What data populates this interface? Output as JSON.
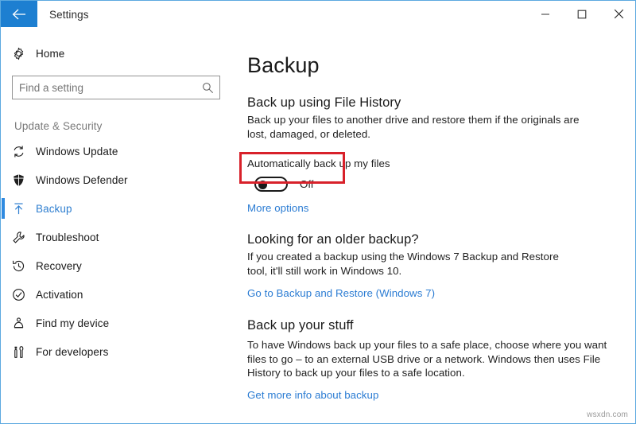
{
  "titlebar": {
    "back_icon": "arrow-left-icon",
    "app_title": "Settings",
    "minimize_label": "minimize-icon",
    "maximize_label": "maximize-icon",
    "close_label": "close-icon"
  },
  "sidebar": {
    "home": {
      "label": "Home",
      "icon": "gear-icon"
    },
    "search": {
      "value": "",
      "placeholder": "Find a setting",
      "icon": "search-icon"
    },
    "group_heading": "Update & Security",
    "items": [
      {
        "label": "Windows Update",
        "icon": "refresh-icon",
        "selected": false
      },
      {
        "label": "Windows Defender",
        "icon": "shield-icon",
        "selected": false
      },
      {
        "label": "Backup",
        "icon": "upload-arrow-icon",
        "selected": true
      },
      {
        "label": "Troubleshoot",
        "icon": "wrench-icon",
        "selected": false
      },
      {
        "label": "Recovery",
        "icon": "history-clock-icon",
        "selected": false
      },
      {
        "label": "Activation",
        "icon": "check-circle-icon",
        "selected": false
      },
      {
        "label": "Find my device",
        "icon": "person-locator-icon",
        "selected": false
      },
      {
        "label": "For developers",
        "icon": "tools-icon",
        "selected": false
      }
    ]
  },
  "main": {
    "page_title": "Backup",
    "file_history": {
      "heading": "Back up using File History",
      "body": "Back up your files to another drive and restore them if the originals are lost, damaged, or deleted.",
      "toggle_label": "Automatically back up my files",
      "toggle_state": "Off",
      "more_options_link": "More options"
    },
    "older_backup": {
      "heading": "Looking for an older backup?",
      "body": "If you created a backup using the Windows 7 Backup and Restore tool, it'll still work in Windows 10.",
      "link": "Go to Backup and Restore (Windows 7)"
    },
    "back_up_stuff": {
      "heading": "Back up your stuff",
      "body": "To have Windows back up your files to a safe place, choose where you want files to go – to an external USB drive or a network. Windows then uses File History to back up your files to a safe location.",
      "link": "Get more info about backup"
    }
  },
  "watermark": "wsxdn.com",
  "colors": {
    "accent_blue": "#1d7fd1",
    "link_blue": "#2b7cd3",
    "selected_blue": "#2f8ae0",
    "annotation_red": "#d8212a"
  }
}
